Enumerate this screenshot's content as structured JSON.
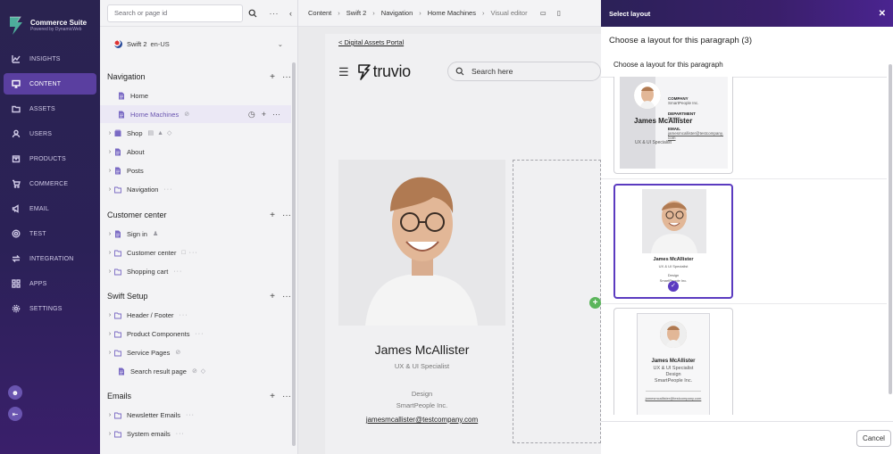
{
  "brand": {
    "title": "Commerce Suite",
    "subtitle": "Powered by DynamicWeb"
  },
  "rail": {
    "items": [
      {
        "label": "INSIGHTS",
        "icon": "chart-line-icon",
        "active": false
      },
      {
        "label": "CONTENT",
        "icon": "monitor-icon",
        "active": true
      },
      {
        "label": "ASSETS",
        "icon": "folder-icon",
        "active": false
      },
      {
        "label": "USERS",
        "icon": "user-icon",
        "active": false
      },
      {
        "label": "PRODUCTS",
        "icon": "box-icon",
        "active": false
      },
      {
        "label": "COMMERCE",
        "icon": "cart-icon",
        "active": false
      },
      {
        "label": "EMAIL",
        "icon": "megaphone-icon",
        "active": false
      },
      {
        "label": "TEST",
        "icon": "target-icon",
        "active": false
      },
      {
        "label": "INTEGRATION",
        "icon": "arrows-icon",
        "active": false
      },
      {
        "label": "APPS",
        "icon": "grid-icon",
        "active": false
      },
      {
        "label": "SETTINGS",
        "icon": "gear-icon",
        "active": false
      }
    ]
  },
  "tree": {
    "search_placeholder": "Search or page id",
    "website": "Swift 2",
    "language": "en-US",
    "sections": {
      "navigation": "Navigation",
      "customer_center": "Customer center",
      "swift_setup": "Swift Setup",
      "emails": "Emails"
    },
    "nodes": {
      "home": "Home",
      "home_machines": "Home Machines",
      "shop": "Shop",
      "about": "About",
      "posts": "Posts",
      "navigation": "Navigation",
      "sign_in": "Sign in",
      "customer_center": "Customer center",
      "shopping_cart": "Shopping cart",
      "header_footer": "Header / Footer",
      "product_components": "Product Components",
      "service_pages": "Service Pages",
      "search_result_page": "Search result page",
      "newsletter_emails": "Newsletter Emails",
      "system_emails": "System emails"
    }
  },
  "breadcrumb": {
    "items": [
      "Content",
      "Swift 2",
      "Navigation",
      "Home Machines"
    ],
    "current": "Visual editor"
  },
  "preview": {
    "back_link": "< Digital Assets Portal",
    "logo_text": "truvio",
    "search_placeholder": "Search here",
    "profile": {
      "name": "James McAllister",
      "role": "UX & UI Specialist",
      "department": "Design",
      "company": "SmartPeople Inc.",
      "email": "jamesmcallister@testcompany.com"
    }
  },
  "modal": {
    "header": "Select layout",
    "title": "Choose a layout for this paragraph (3)",
    "subtitle": "Choose a layout for this paragraph",
    "cancel_label": "Cancel",
    "option_a": {
      "name": "James McAllister",
      "role": "UX & UI Specialist",
      "company_label": "COMPANY",
      "company": "SmartPeople Inc.",
      "department_label": "DEPARTMENT",
      "department": "Design",
      "email_label": "EMAIL",
      "email": "jamesmcallister@testcompany.com"
    },
    "option_b": {
      "name": "James McAllister",
      "role": "UX & UI Specialist",
      "department": "Design",
      "company": "SmartPeople Inc."
    },
    "option_c": {
      "name": "James McAllister",
      "role": "UX & UI Specialist",
      "department": "Design",
      "company": "SmartPeople Inc.",
      "email": "jamesmcallister@testcompany.com"
    }
  },
  "colors": {
    "accent": "#5b3bc0",
    "rail": "#2b2157",
    "add": "#5bb55b"
  }
}
